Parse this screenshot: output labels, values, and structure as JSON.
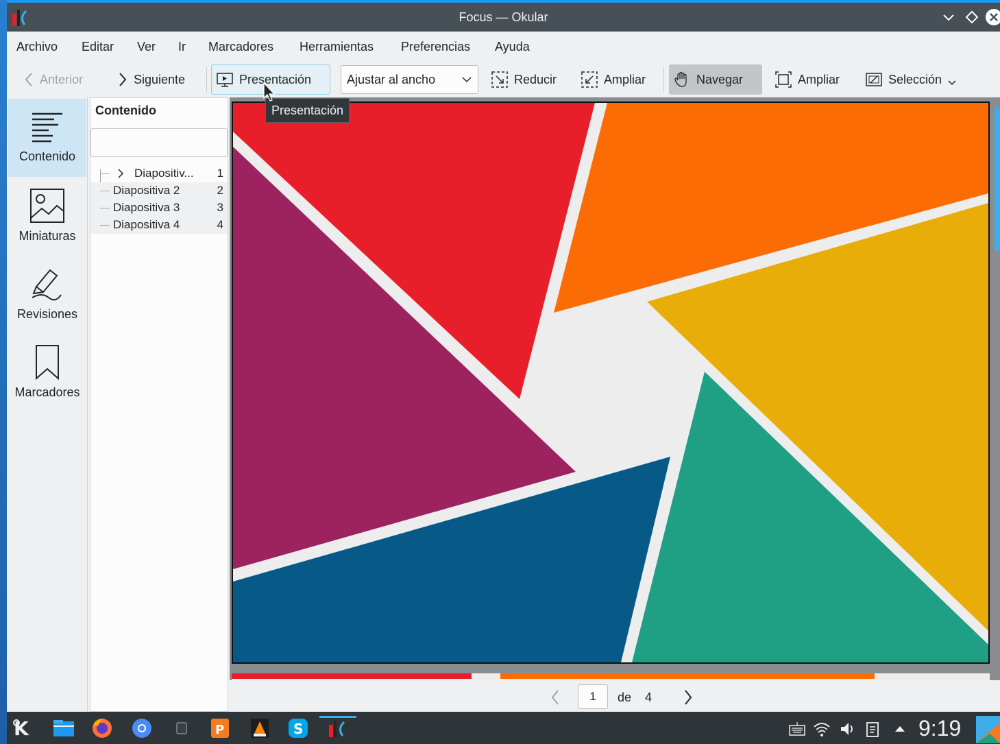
{
  "window": {
    "title": "Focus — Okular"
  },
  "menu": [
    "Archivo",
    "Editar",
    "Ver",
    "Ir",
    "Marcadores",
    "Herramientas",
    "Preferencias",
    "Ayuda"
  ],
  "toolbar": {
    "previous": "Anterior",
    "next": "Siguiente",
    "presentation": "Presentación",
    "zoom_mode": "Ajustar al ancho",
    "zoom_out": "Reducir",
    "zoom_in": "Ampliar",
    "browse": "Navegar",
    "zoom_tool": "Ampliar",
    "selection": "Selección"
  },
  "tooltip": "Presentación",
  "sidebar": {
    "items": [
      {
        "label": "Contenido",
        "icon": "contents-icon",
        "selected": true
      },
      {
        "label": "Miniaturas",
        "icon": "thumbnails-icon",
        "selected": false
      },
      {
        "label": "Revisiones",
        "icon": "reviews-icon",
        "selected": false
      },
      {
        "label": "Marcadores",
        "icon": "bookmark-icon",
        "selected": false
      }
    ]
  },
  "contents_panel": {
    "header": "Contenido",
    "search_value": "",
    "entries": [
      {
        "label": "Diapositiv...",
        "page": "1",
        "expandable": true
      },
      {
        "label": "Diapositiva 2",
        "page": "2",
        "expandable": false
      },
      {
        "label": "Diapositiva 3",
        "page": "3",
        "expandable": false
      },
      {
        "label": "Diapositiva 4",
        "page": "4",
        "expandable": false
      }
    ]
  },
  "page_nav": {
    "current": "1",
    "of_label": "de",
    "total": "4"
  },
  "slide_colors": {
    "red": "#e91e2b",
    "orange": "#fc6c05",
    "yellow": "#e8ad08",
    "purple": "#9d2260",
    "blue": "#075a88",
    "teal": "#1fa085",
    "background": "#ededed"
  },
  "taskbar": {
    "clock": "9:19",
    "apps": [
      "kde-launcher-icon",
      "file-manager-icon",
      "firefox-icon",
      "chromium-icon",
      "scratch-icon",
      "presentation-app-icon",
      "vlc-icon",
      "skype-icon",
      "okular-icon"
    ]
  }
}
